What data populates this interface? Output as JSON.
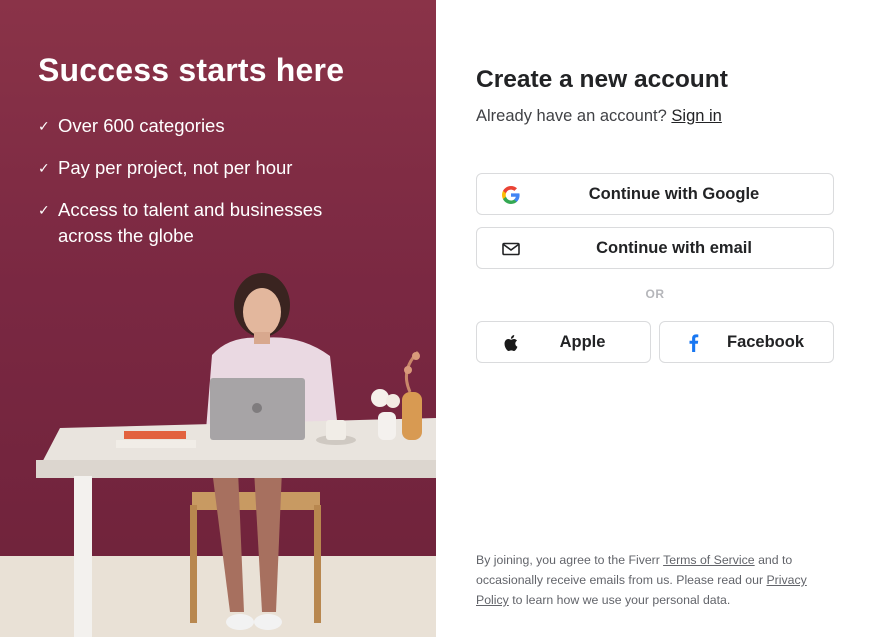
{
  "promo": {
    "headline": "Success starts here",
    "bullets": [
      {
        "text": "Over 600 categories"
      },
      {
        "text": "Pay per project, not per hour"
      },
      {
        "text": "Access to talent and businesses across the globe"
      }
    ],
    "check_glyph": "✓"
  },
  "form": {
    "title": "Create a new account",
    "already_text": "Already have an account?",
    "signin_label": "Sign in",
    "google_label": "Continue with Google",
    "email_label": "Continue with email",
    "or_label": "OR",
    "apple_label": "Apple",
    "facebook_label": "Facebook"
  },
  "legal": {
    "prefix": "By joining, you agree to the Fiverr",
    "terms_label": "Terms of Service",
    "middle": "and to occasionally receive emails from us. Please read our",
    "privacy_label": "Privacy Policy",
    "suffix": "to learn how we use your personal data."
  },
  "colors": {
    "promo_bg": "#7a2842",
    "text_dark": "#222325",
    "border": "#dadbdd",
    "facebook_blue": "#1877f2"
  },
  "icons": [
    "check-icon",
    "google-icon",
    "mail-icon",
    "apple-icon",
    "facebook-icon"
  ]
}
